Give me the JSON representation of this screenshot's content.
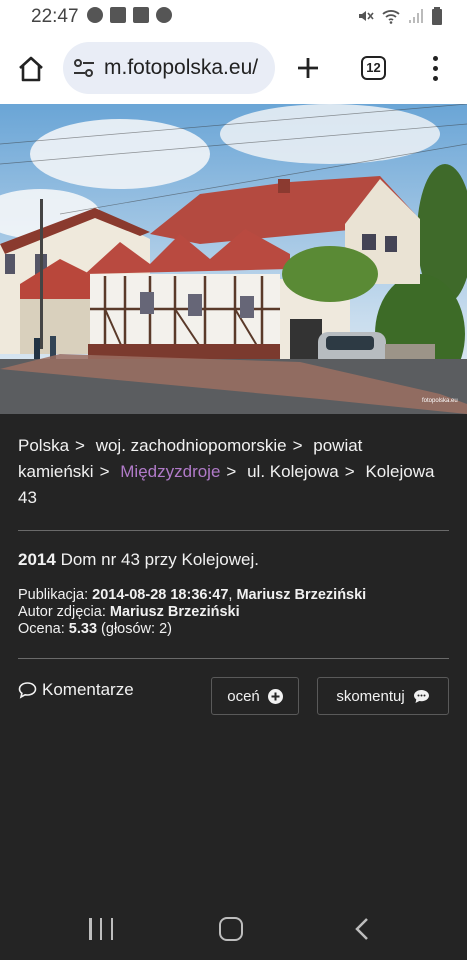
{
  "status_bar": {
    "time": "22:47"
  },
  "browser": {
    "url": "m.fotopolska.eu/",
    "tab_count": "12"
  },
  "breadcrumb": {
    "items": [
      "Polska",
      "woj. zachodniopomorskie",
      "powiat kamieński",
      "Międzyzdroje",
      "ul. Kolejowa",
      "Kolejowa 43"
    ],
    "active_index": 3,
    "separator": ">"
  },
  "photo": {
    "watermark": "fotopolska.eu"
  },
  "photo_info": {
    "year": "2014",
    "title": "Dom nr 43 przy Kolejowej.",
    "publication_label": "Publikacja:",
    "publication_date": "2014-08-28 18:36:47",
    "publication_sep": ",",
    "publication_author": "Mariusz Brzeziński",
    "author_label": "Autor zdjęcia:",
    "author": "Mariusz Brzeziński",
    "rating_label": "Ocena:",
    "rating": "5.33",
    "votes": "(głosów: 2)"
  },
  "actions": {
    "comments_label": "Komentarze",
    "rate_label": "oceń",
    "comment_label": "skomentuj"
  },
  "colors": {
    "accent_link": "#b07ac8",
    "page_bg": "#242424"
  }
}
